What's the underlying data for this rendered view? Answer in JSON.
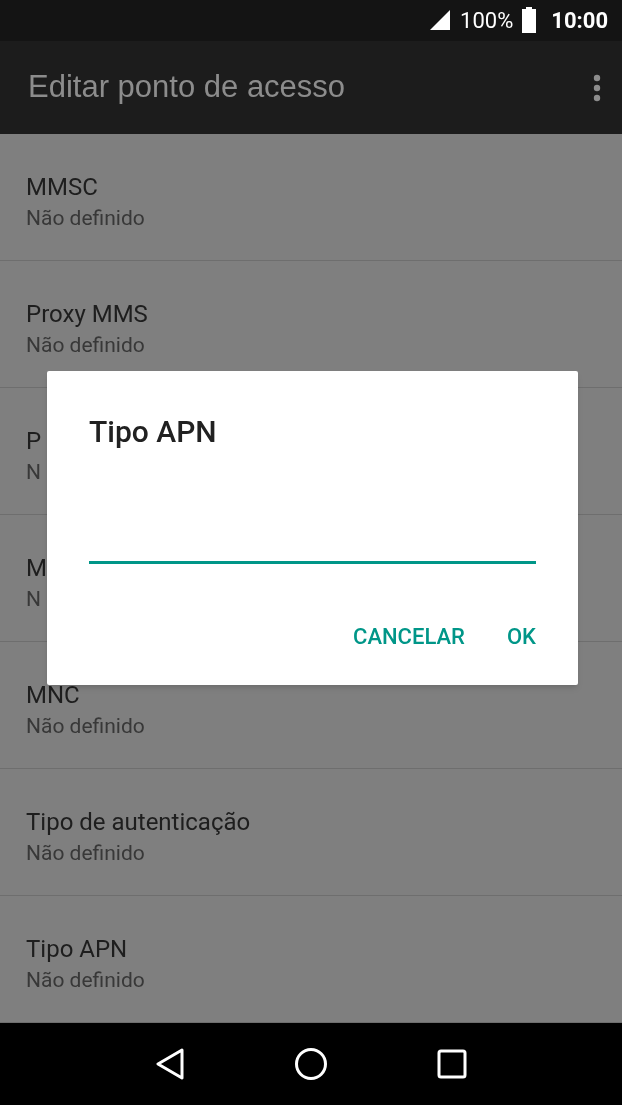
{
  "status_bar": {
    "battery": "100%",
    "time": "10:00"
  },
  "app_bar": {
    "title": "Editar ponto de acesso"
  },
  "rows": [
    {
      "title": "MMSC",
      "value": "Não definido"
    },
    {
      "title": "Proxy MMS",
      "value": "Não definido"
    },
    {
      "title": "P",
      "value": "N"
    },
    {
      "title": "M",
      "value": "N"
    },
    {
      "title": "MNC",
      "value": "Não definido"
    },
    {
      "title": "Tipo de autenticação",
      "value": "Não definido"
    },
    {
      "title": "Tipo APN",
      "value": "Não definido"
    }
  ],
  "dialog": {
    "title": "Tipo APN",
    "buttons": [
      "CANCELAR",
      "OK"
    ]
  }
}
